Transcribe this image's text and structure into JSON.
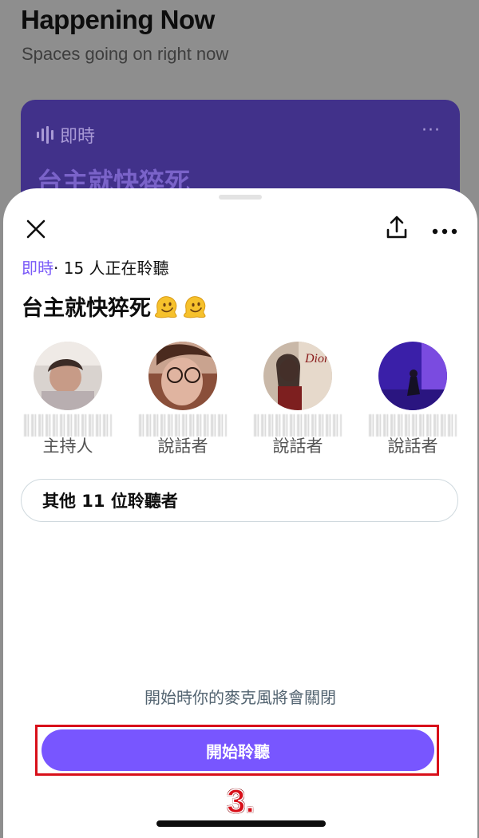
{
  "background": {
    "title": "Happening Now",
    "subtitle": "Spaces going on right now",
    "card": {
      "live_label": "即時",
      "more_glyph": "···",
      "title": "台主就快猝死"
    }
  },
  "sheet": {
    "live_label": "即時",
    "listening_text": "· 15 人正在聆聽",
    "title": "台主就快猝死",
    "title_emoji": [
      "melting-face",
      "melting-face"
    ],
    "participants": [
      {
        "role": "主持人"
      },
      {
        "role": "說話者"
      },
      {
        "role": "說話者"
      },
      {
        "role": "說話者"
      }
    ],
    "other_listeners": "其他 11 位聆聽者",
    "mic_note": "開始時你的麥克風將會關閉",
    "start_button": "開始聆聽",
    "step_label": "3."
  },
  "colors": {
    "accent": "#7856ff",
    "live_text": "#7a5af8",
    "annotation": "#d8101a",
    "background_card": "#41318a"
  }
}
